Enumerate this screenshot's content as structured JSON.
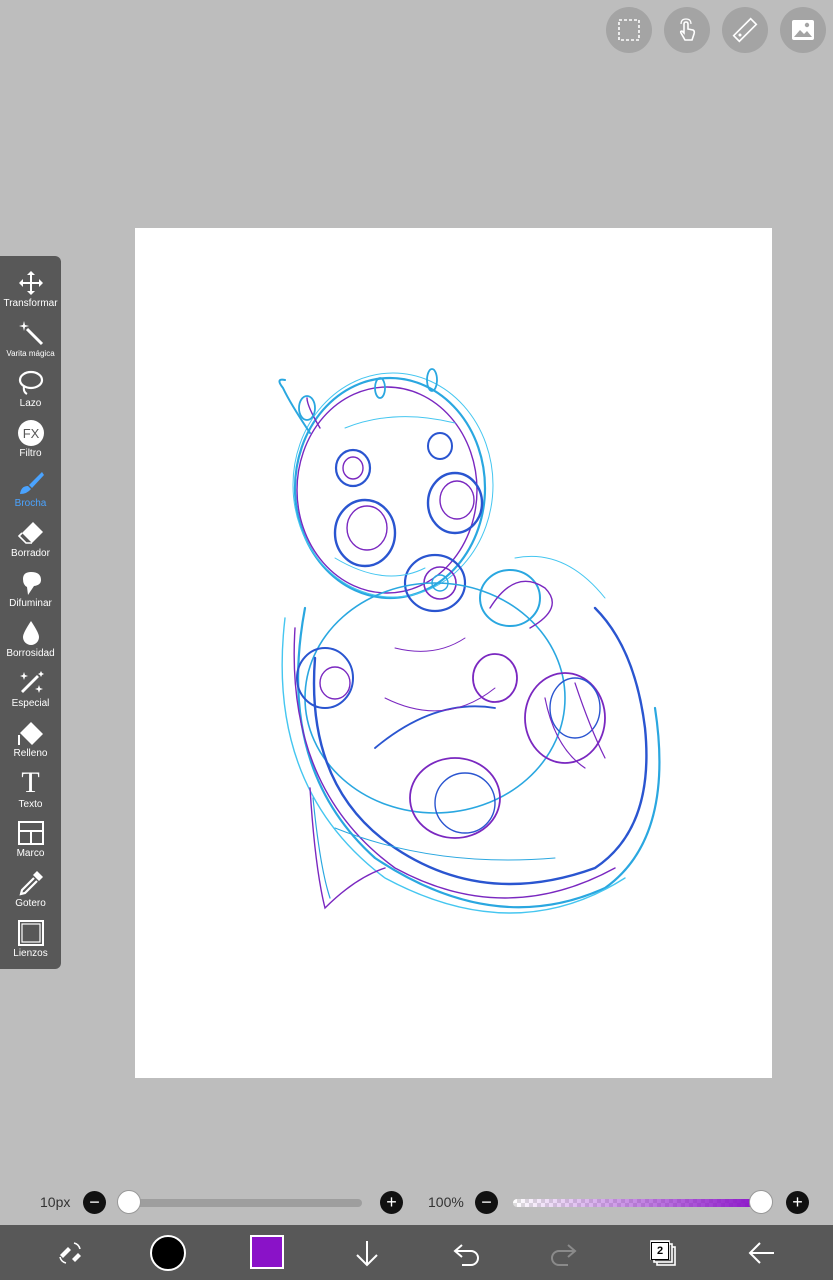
{
  "top_buttons": [
    {
      "name": "selection",
      "icon": "dashed-square-icon"
    },
    {
      "name": "gesture",
      "icon": "touch-hand-icon"
    },
    {
      "name": "ruler",
      "icon": "ruler-icon"
    },
    {
      "name": "image",
      "icon": "image-icon"
    }
  ],
  "tools": [
    {
      "label": "Transformar",
      "icon": "move-arrows-icon"
    },
    {
      "label": "Varita mágica",
      "icon": "magic-wand-icon"
    },
    {
      "label": "Lazo",
      "icon": "lasso-icon"
    },
    {
      "label": "Filtro",
      "icon": "fx-icon",
      "fx_text": "FX"
    },
    {
      "label": "Brocha",
      "icon": "brush-icon",
      "active": true
    },
    {
      "label": "Borrador",
      "icon": "eraser-icon"
    },
    {
      "label": "Difuminar",
      "icon": "smudge-icon"
    },
    {
      "label": "Borrosidad",
      "icon": "blur-drop-icon"
    },
    {
      "label": "Especial",
      "icon": "sparkle-pen-icon"
    },
    {
      "label": "Relleno",
      "icon": "fill-bucket-icon"
    },
    {
      "label": "Texto",
      "icon": "text-icon",
      "glyph": "T"
    },
    {
      "label": "Marco",
      "icon": "frame-icon"
    },
    {
      "label": "Gotero",
      "icon": "eyedropper-icon"
    },
    {
      "label": "Lienzos",
      "icon": "canvas-icon"
    }
  ],
  "brush": {
    "size_label": "10px",
    "size_fraction": 0.0,
    "opacity_label": "100%",
    "opacity_fraction": 1.0,
    "minus": "−",
    "plus": "+"
  },
  "colors": {
    "primary": "#000000",
    "secondary": "#8a12c8",
    "accent_active": "#4aa3ff",
    "opacity_gradient_end": "#8a12c8"
  },
  "bottom_bar": [
    {
      "name": "tools-swap",
      "icon": "tools-swap-icon"
    },
    {
      "name": "primary-color",
      "icon": "color-circle"
    },
    {
      "name": "secondary-color",
      "icon": "color-square"
    },
    {
      "name": "download",
      "icon": "arrow-down-icon"
    },
    {
      "name": "undo",
      "icon": "undo-icon"
    },
    {
      "name": "redo",
      "icon": "redo-icon",
      "disabled": true
    },
    {
      "name": "layers",
      "icon": "layers-icon"
    },
    {
      "name": "back",
      "icon": "arrow-left-icon"
    }
  ],
  "layers_count": "2"
}
